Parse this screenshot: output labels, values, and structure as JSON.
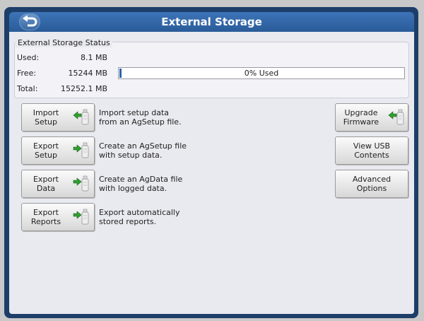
{
  "header": {
    "title": "External Storage",
    "back_icon": "back-arrow-icon"
  },
  "status": {
    "title": "External Storage Status",
    "used_label": "Used:",
    "used_value": "8.1 MB",
    "free_label": "Free:",
    "free_value": "15244 MB",
    "total_label": "Total:",
    "total_value": "15252.1 MB",
    "progress_text": "0% Used",
    "percent_used": 0
  },
  "actions": [
    {
      "label": "Import\nSetup",
      "description": "Import setup data\nfrom an AgSetup file.",
      "direction": "import"
    },
    {
      "label": "Export\nSetup",
      "description": "Create an AgSetup file\nwith setup data.",
      "direction": "export"
    },
    {
      "label": "Export\nData",
      "description": "Create an AgData file\nwith logged data.",
      "direction": "export"
    },
    {
      "label": "Export\nReports",
      "description": "Export automatically\nstored reports.",
      "direction": "export"
    }
  ],
  "side_buttons": [
    {
      "label": "Upgrade\nFirmware",
      "icon": "usb-import-icon"
    },
    {
      "label": "View USB\nContents"
    },
    {
      "label": "Advanced\nOptions"
    }
  ],
  "colors": {
    "header": "#2f62a3",
    "arrow_green": "#2fa02f",
    "progress_fill": "#2a62b0"
  }
}
